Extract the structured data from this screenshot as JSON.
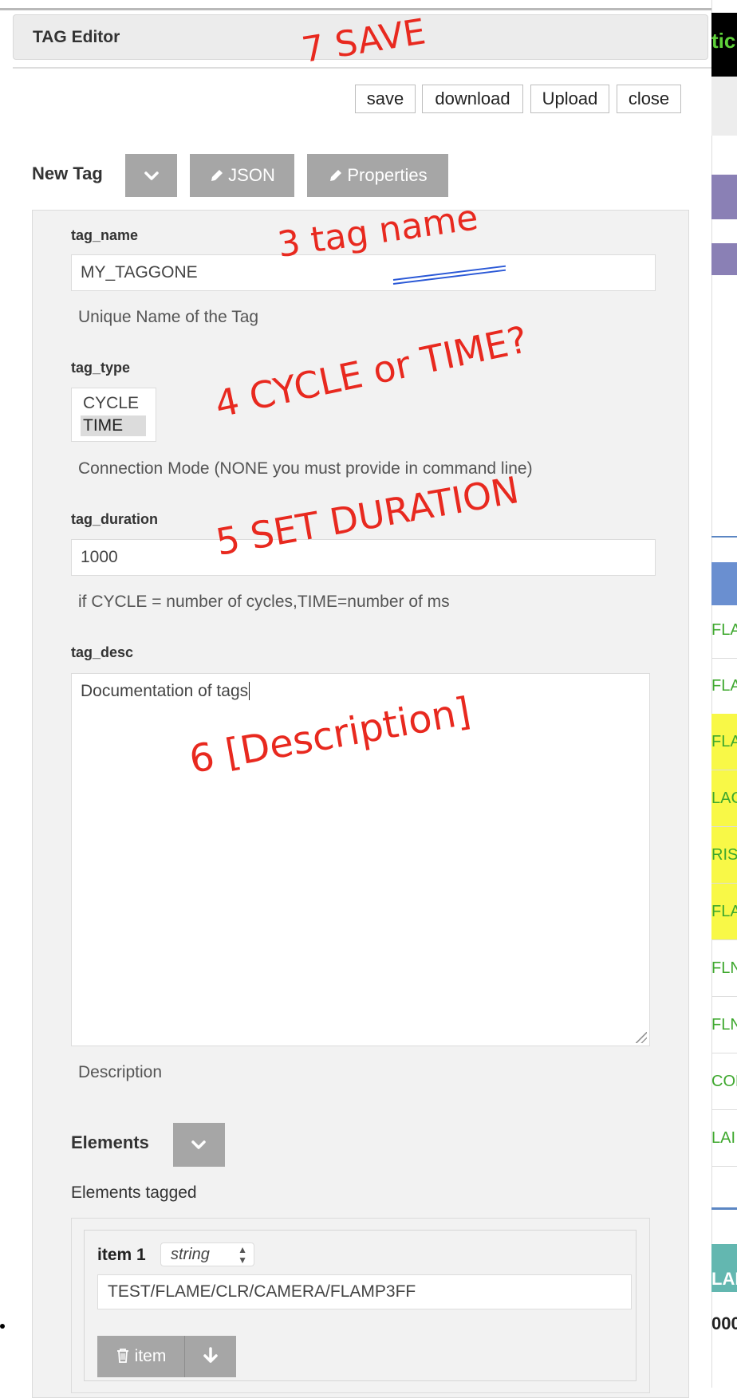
{
  "window": {
    "title": "TAG Editor"
  },
  "toolbar": {
    "save": "save",
    "download": "download",
    "upload": "Upload",
    "close": "close"
  },
  "header": {
    "label": "New Tag",
    "json_button": "JSON",
    "properties_button": "Properties"
  },
  "form": {
    "tag_name": {
      "label": "tag_name",
      "value": "MY_TAGGONE",
      "help": "Unique Name of the Tag"
    },
    "tag_type": {
      "label": "tag_type",
      "options": [
        "CYCLE",
        "TIME"
      ],
      "selected": "TIME",
      "help": "Connection Mode (NONE you must provide in command line)"
    },
    "tag_duration": {
      "label": "tag_duration",
      "value": "1000",
      "help": "if CYCLE = number of cycles,TIME=number of ms"
    },
    "tag_desc": {
      "label": "tag_desc",
      "value": "Documentation of tags",
      "help": "Description"
    }
  },
  "elements": {
    "label": "Elements",
    "subtitle": "Elements tagged",
    "items": [
      {
        "label": "item 1",
        "type": "string",
        "value": "TEST/FLAME/CLR/CAMERA/FLAMP3FF",
        "delete_label": "item"
      }
    ]
  },
  "annotations": {
    "save": "7 SAVE",
    "tag_name": "3 tag name",
    "tag_type": "4 CYCLE or TIME?",
    "duration": "5 SET DURATION",
    "description": "6 [Description]"
  },
  "background_page": {
    "header_text": "tic",
    "rows": [
      "FLA",
      "FLA",
      "FLA",
      "LAC",
      "RIS_",
      "FLA",
      "FLN",
      "FLN",
      "CON",
      "LAI"
    ],
    "teal_text": "LAN",
    "bold_text": "000"
  },
  "colors": {
    "annotation": "#e8291f",
    "button_gray": "#a6a6a6",
    "panel_bg": "#f2f2f2",
    "highlight_yellow": "#f8f847",
    "row_text_green": "#3ea82e"
  }
}
